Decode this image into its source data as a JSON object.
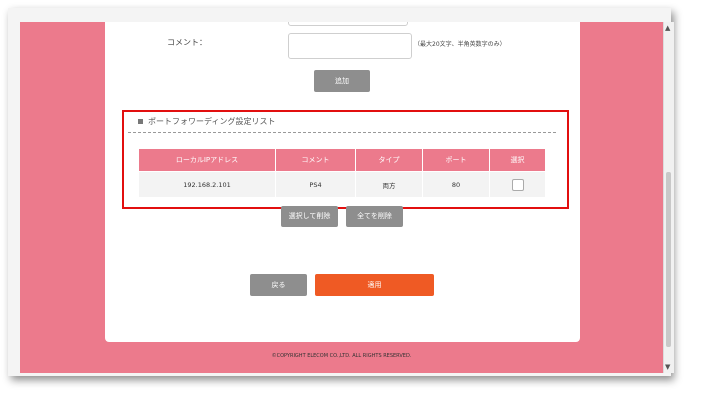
{
  "form": {
    "comment_label": "コメント：",
    "comment_value": "",
    "comment_hint": "（最大20文字、半角英数字のみ）",
    "add_button": "追加"
  },
  "port_forward_list": {
    "title": "ポートフォワーディング設定リスト",
    "headers": [
      "ローカルIPアドレス",
      "コメント",
      "タイプ",
      "ポート",
      "選択"
    ],
    "rows": [
      {
        "ip": "192.168.2.101",
        "comment": "PS4",
        "type": "両方",
        "port": "80",
        "selected": false
      }
    ],
    "delete_selected_button": "選択して削除",
    "delete_all_button": "全てを削除"
  },
  "footer": {
    "back_button": "戻る",
    "apply_button": "適用",
    "copyright": "©COPYRIGHT ELECOM CO.,LTD. ALL RIGHTS RESERVED."
  },
  "colors": {
    "background_pink": "#ec7a8c",
    "apply_orange": "#ef5a24",
    "highlight_red": "#e20f0f",
    "button_gray": "#8e8e8e"
  }
}
